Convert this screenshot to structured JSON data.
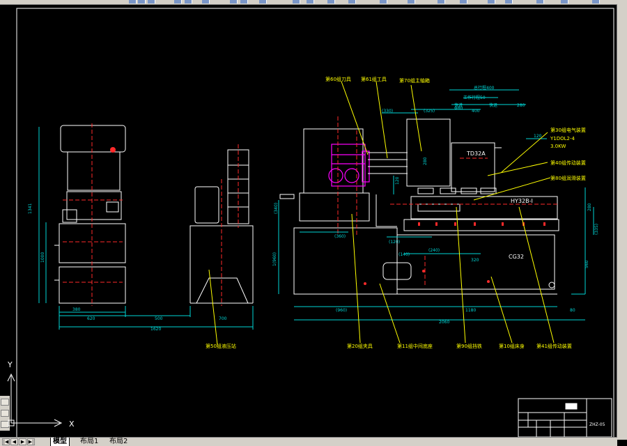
{
  "colors": {
    "background": "#000000",
    "outline": "#ffffff",
    "dimension": "#00d6d6",
    "leader": "#ffff00",
    "center": "#ff2a2a",
    "part": "#ff00ff",
    "text": "#ffff00"
  },
  "drawing": {
    "top_dims": [
      "总行程400",
      "工作行程50",
      "快进",
      "快退",
      "(330)",
      "(325)",
      "400",
      "120",
      "280",
      "280",
      "Φ80"
    ],
    "side_dims": [
      "1341",
      "1000",
      "(340)",
      "1(960)",
      "(120)",
      "(140)",
      "120",
      "280",
      "(335)",
      "560"
    ],
    "bottom_dims": [
      "380",
      "620",
      "500",
      "700",
      "1620",
      "(960)",
      "1180",
      "80",
      "2060",
      "320",
      "(360)",
      "(240)"
    ],
    "labels_left": [
      "第50组液压站"
    ],
    "leader_labels_top": [
      "第60组刀具",
      "第61组工具",
      "第70组主轴箱"
    ],
    "leader_labels_right": [
      "第30组电气装置",
      "Y1DOL2-4",
      "3.0KW",
      "第40组传动装置",
      "第80组润滑装置"
    ],
    "leader_labels_bottom": [
      "第20组夹具",
      "第11组中间底座",
      "第90组挡铁",
      "第10组床身",
      "第41组传动装置"
    ],
    "part_labels": [
      "TD32A",
      "HY32B-I",
      "CG32"
    ],
    "title_block": {
      "drawing_number": "ZHZ-05"
    }
  },
  "ucs": {
    "x_label": "X",
    "y_label": "Y"
  },
  "tabs": [
    "模型",
    "布局1",
    "布局2"
  ]
}
